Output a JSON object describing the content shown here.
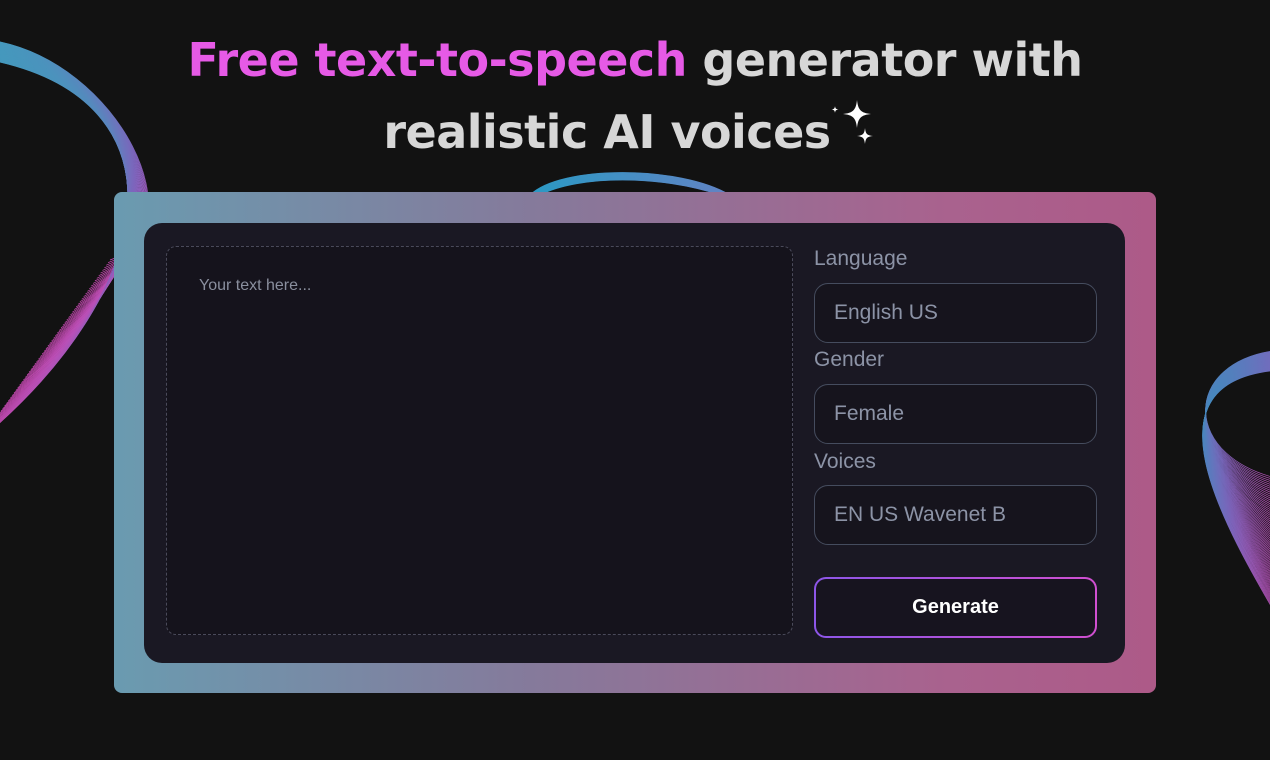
{
  "headline": {
    "accent_text": "Free text-to-speech",
    "rest_line1": " generator with",
    "line2": "realistic AI voices"
  },
  "editor": {
    "placeholder": "Your text here...",
    "value": ""
  },
  "settings": {
    "language_label": "Language",
    "language_value": "English US",
    "gender_label": "Gender",
    "gender_value": "Female",
    "voices_label": "Voices",
    "voices_value": "EN US Wavenet B"
  },
  "actions": {
    "generate_label": "Generate"
  },
  "colors": {
    "background": "#121212",
    "accent": "#e65ae6",
    "headline": "#d7d7d7",
    "panel": "#1a1823",
    "frame_start": "#6a9bb0",
    "frame_end": "#ad5a88",
    "button_gradient_start": "#8d56e8",
    "button_gradient_end": "#d04fd0"
  },
  "icons": {
    "headline_decoration": "sparkles-icon"
  }
}
